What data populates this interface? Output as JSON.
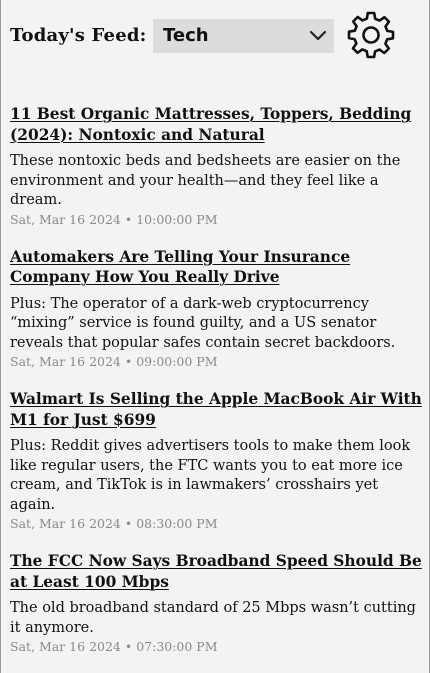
{
  "header": {
    "feed_label": "Today's Feed:",
    "feed_select": {
      "selected": "Tech"
    },
    "settings_icon": "gear-icon"
  },
  "articles": [
    {
      "title": "11 Best Organic Mattresses, Toppers, Bedding (2024): Nontoxic and Natural",
      "summary": "These nontoxic beds and bedsheets are easier on the environment and your health—and they feel like a dream.",
      "date": "Sat, Mar 16 2024 • 10:00:00 PM"
    },
    {
      "title": "Automakers Are Telling Your Insurance Company How You Really Drive",
      "summary": "Plus: The operator of a dark-web cryptocurrency “mixing” service is found guilty, and a US senator reveals that popular safes contain secret backdoors.",
      "date": "Sat, Mar 16 2024 • 09:00:00 PM"
    },
    {
      "title": "Walmart Is Selling the Apple MacBook Air With M1 for Just $699",
      "summary": "Plus: Reddit gives advertisers tools to make them look like regular users, the FTC wants you to eat more ice cream, and TikTok is in lawmakers’ crosshairs yet again.",
      "date": "Sat, Mar 16 2024 • 08:30:00 PM"
    },
    {
      "title": "The FCC Now Says Broadband Speed Should Be at Least 100 Mbps",
      "summary": "The old broadband standard of 25 Mbps wasn’t cutting it anymore.",
      "date": "Sat, Mar 16 2024 • 07:30:00 PM"
    }
  ]
}
